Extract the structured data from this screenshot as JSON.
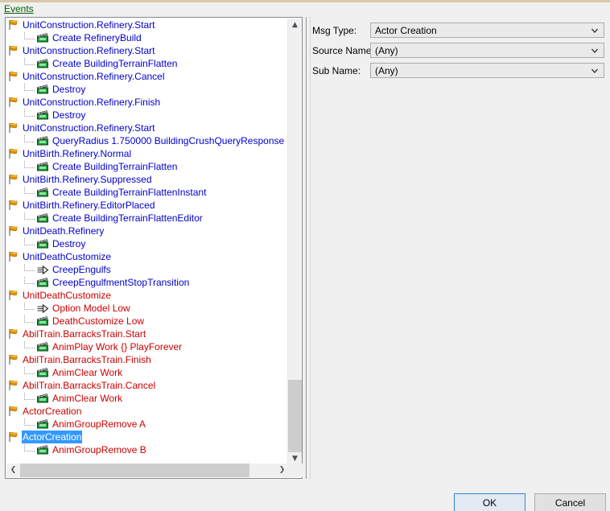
{
  "section": {
    "events_label": "Events"
  },
  "tree": {
    "rows": [
      {
        "type": "event",
        "icon": "flag-icon",
        "color": "blue",
        "label": "UnitConstruction.Refinery.Start"
      },
      {
        "type": "action",
        "icon": "clapperboard-icon",
        "color": "blue",
        "label": "Create RefineryBuild"
      },
      {
        "type": "event",
        "icon": "flag-icon",
        "color": "blue",
        "label": "UnitConstruction.Refinery.Start"
      },
      {
        "type": "action",
        "icon": "clapperboard-icon",
        "color": "blue",
        "label": "Create BuildingTerrainFlatten"
      },
      {
        "type": "event",
        "icon": "flag-icon",
        "color": "blue",
        "label": "UnitConstruction.Refinery.Cancel"
      },
      {
        "type": "action",
        "icon": "clapperboard-icon",
        "color": "blue",
        "label": "Destroy"
      },
      {
        "type": "event",
        "icon": "flag-icon",
        "color": "blue",
        "label": "UnitConstruction.Refinery.Finish"
      },
      {
        "type": "action",
        "icon": "clapperboard-icon",
        "color": "blue",
        "label": "Destroy"
      },
      {
        "type": "event",
        "icon": "flag-icon",
        "color": "blue",
        "label": "UnitConstruction.Refinery.Start"
      },
      {
        "type": "action",
        "icon": "clapperboard-icon",
        "color": "blue",
        "label": "QueryRadius 1.750000 BuildingCrushQueryResponse"
      },
      {
        "type": "event",
        "icon": "flag-icon",
        "color": "blue",
        "label": "UnitBirth.Refinery.Normal"
      },
      {
        "type": "action",
        "icon": "clapperboard-icon",
        "color": "blue",
        "label": "Create BuildingTerrainFlatten"
      },
      {
        "type": "event",
        "icon": "flag-icon",
        "color": "blue",
        "label": "UnitBirth.Refinery.Suppressed"
      },
      {
        "type": "action",
        "icon": "clapperboard-icon",
        "color": "blue",
        "label": "Create BuildingTerrainFlattenInstant"
      },
      {
        "type": "event",
        "icon": "flag-icon",
        "color": "blue",
        "label": "UnitBirth.Refinery.EditorPlaced"
      },
      {
        "type": "action",
        "icon": "clapperboard-icon",
        "color": "blue",
        "label": "Create BuildingTerrainFlattenEditor"
      },
      {
        "type": "event",
        "icon": "flag-icon",
        "color": "blue",
        "label": "UnitDeath.Refinery"
      },
      {
        "type": "action",
        "icon": "clapperboard-icon",
        "color": "blue",
        "label": "Destroy"
      },
      {
        "type": "event",
        "icon": "flag-icon",
        "color": "blue",
        "label": "UnitDeathCustomize"
      },
      {
        "type": "action",
        "icon": "arrow-icon",
        "color": "blue",
        "label": "CreepEngulfs"
      },
      {
        "type": "action",
        "icon": "clapperboard-icon",
        "color": "blue",
        "label": "CreepEngulfmentStopTransition"
      },
      {
        "type": "event",
        "icon": "flag-icon",
        "color": "red",
        "label": "UnitDeathCustomize"
      },
      {
        "type": "action",
        "icon": "arrow-icon",
        "color": "red",
        "label": "Option Model Low"
      },
      {
        "type": "action",
        "icon": "clapperboard-icon",
        "color": "red",
        "label": "DeathCustomize Low"
      },
      {
        "type": "event",
        "icon": "flag-icon",
        "color": "red",
        "label": "AbilTrain.BarracksTrain.Start"
      },
      {
        "type": "action",
        "icon": "clapperboard-icon",
        "color": "red",
        "label": "AnimPlay Work {} PlayForever"
      },
      {
        "type": "event",
        "icon": "flag-icon",
        "color": "red",
        "label": "AbilTrain.BarracksTrain.Finish"
      },
      {
        "type": "action",
        "icon": "clapperboard-icon",
        "color": "red",
        "label": "AnimClear Work"
      },
      {
        "type": "event",
        "icon": "flag-icon",
        "color": "red",
        "label": "AbilTrain.BarracksTrain.Cancel"
      },
      {
        "type": "action",
        "icon": "clapperboard-icon",
        "color": "red",
        "label": "AnimClear Work"
      },
      {
        "type": "event",
        "icon": "flag-icon",
        "color": "red",
        "label": "ActorCreation"
      },
      {
        "type": "action",
        "icon": "clapperboard-icon",
        "color": "red",
        "label": "AnimGroupRemove A"
      },
      {
        "type": "event",
        "icon": "flag-icon",
        "color": "red",
        "label": "ActorCreation",
        "selected": true
      },
      {
        "type": "action",
        "icon": "clapperboard-icon",
        "color": "red",
        "label": "AnimGroupRemove B"
      }
    ],
    "scrollbars": {
      "vertical_up_glyph": "▲",
      "vertical_down_glyph": "▼",
      "horizontal_left_glyph": "❮",
      "horizontal_right_glyph": "❯"
    }
  },
  "form": {
    "fields": [
      {
        "label": "Msg Type:",
        "value": "Actor Creation"
      },
      {
        "label": "Source Name:",
        "value": "(Any)"
      },
      {
        "label": "Sub Name:",
        "value": "(Any)"
      }
    ]
  },
  "buttons": {
    "ok": "OK",
    "cancel": "Cancel"
  },
  "colors": {
    "event_blue": "#0000cc",
    "event_red": "#cc0000",
    "selection_blue": "#3399ff",
    "events_label_green": "#006000",
    "dialog_background": "#f0f0f0"
  }
}
